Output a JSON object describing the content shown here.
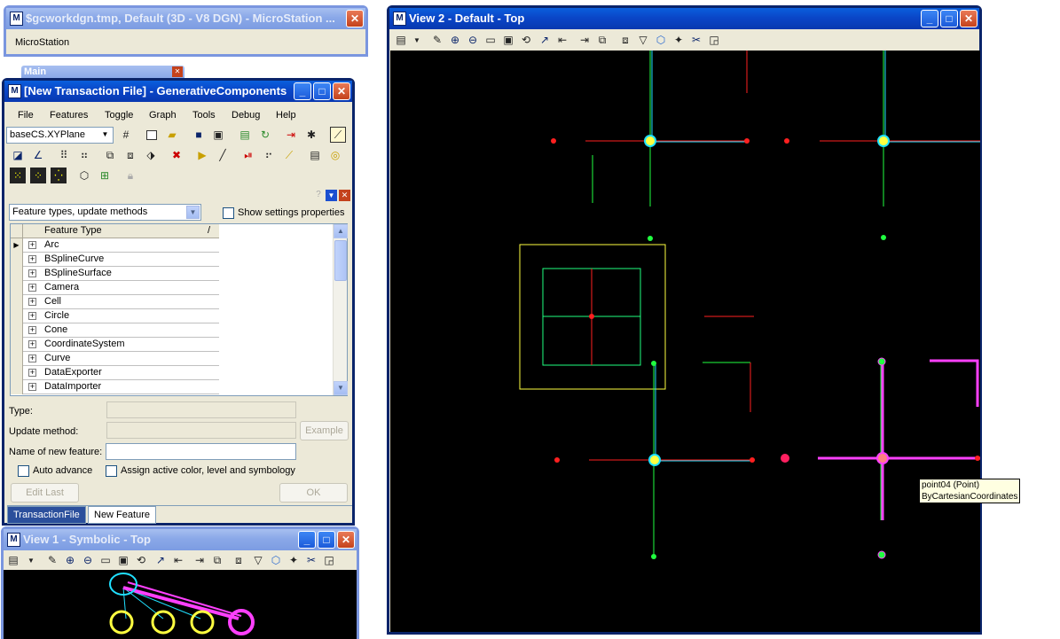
{
  "microstation": {
    "title": "$gcworkdgn.tmp, Default (3D - V8 DGN) - MicroStation ...",
    "label": "MicroStation"
  },
  "main_palette": {
    "title": "Main"
  },
  "gc_window": {
    "title": "[New Transaction File] - GenerativeComponents",
    "menu": [
      "File",
      "Features",
      "Toggle",
      "Graph",
      "Tools",
      "Debug",
      "Help"
    ],
    "cs_value": "baseCS.XYPlane",
    "feature_filter": "Feature types, update methods",
    "show_settings_label": "Show settings properties",
    "grid_header": "Feature Type",
    "grid_sort_symbol": "/",
    "feature_types": [
      "Arc",
      "BSplineCurve",
      "BSplineSurface",
      "Camera",
      "Cell",
      "Circle",
      "Cone",
      "CoordinateSystem",
      "Curve",
      "DataExporter",
      "DataImporter"
    ],
    "type_label": "Type:",
    "type_value": "",
    "update_method_label": "Update method:",
    "update_method_value": "",
    "example_label": "Example",
    "name_label": "Name of new feature:",
    "name_value": "",
    "auto_advance_label": "Auto advance",
    "assign_color_label": "Assign active color, level and symbology",
    "edit_last_label": "Edit Last",
    "ok_label": "OK",
    "tabs": [
      "TransactionFile",
      "New Feature"
    ],
    "active_tab": 1
  },
  "view1": {
    "title": "View 1 - Symbolic - Top"
  },
  "view2": {
    "title": "View 2 - Default - Top",
    "tooltip_line1": "point04 (Point)",
    "tooltip_line2": "ByCartesianCoordinates"
  },
  "colors": {
    "title_active": "#0a46c8",
    "title_inactive": "#8aa8e8",
    "canvas": "#000000",
    "axis_x": "#ff2020",
    "axis_y": "#20ff40",
    "cyan": "#20e0ff",
    "yellow": "#ffff40",
    "magenta": "#ff40ff"
  }
}
